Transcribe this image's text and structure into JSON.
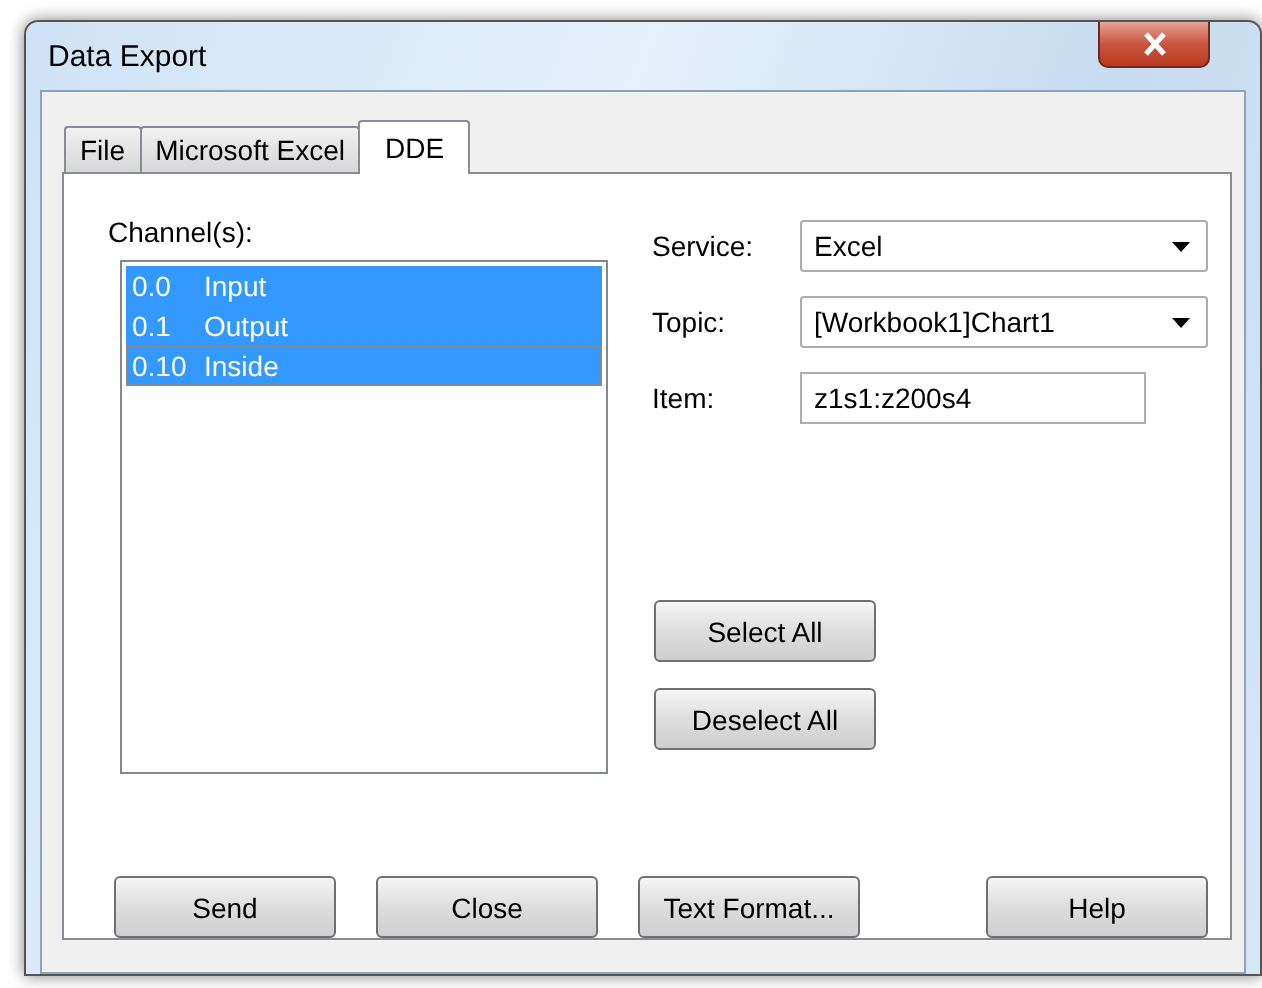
{
  "window": {
    "title": "Data Export"
  },
  "tabs": [
    {
      "label": "File",
      "selected": false
    },
    {
      "label": "Microsoft Excel",
      "selected": false
    },
    {
      "label": "DDE",
      "selected": true
    }
  ],
  "channels": {
    "label": "Channel(s):",
    "items": [
      {
        "number": "0.0",
        "name": "Input",
        "selected": true,
        "focused": false
      },
      {
        "number": "0.1",
        "name": "Output",
        "selected": true,
        "focused": false
      },
      {
        "number": "0.10",
        "name": "Inside",
        "selected": true,
        "focused": true
      }
    ]
  },
  "fields": [
    {
      "kind": "combo",
      "label": "Service:",
      "value": "Excel"
    },
    {
      "kind": "combo",
      "label": "Topic:",
      "value": "[Workbook1]Chart1"
    },
    {
      "kind": "text",
      "label": "Item:",
      "value": "z1s1:z200s4"
    }
  ],
  "side_buttons": [
    "Select All",
    "Deselect All"
  ],
  "buttons": [
    "Send",
    "Close",
    "Text Format...",
    "Help"
  ]
}
